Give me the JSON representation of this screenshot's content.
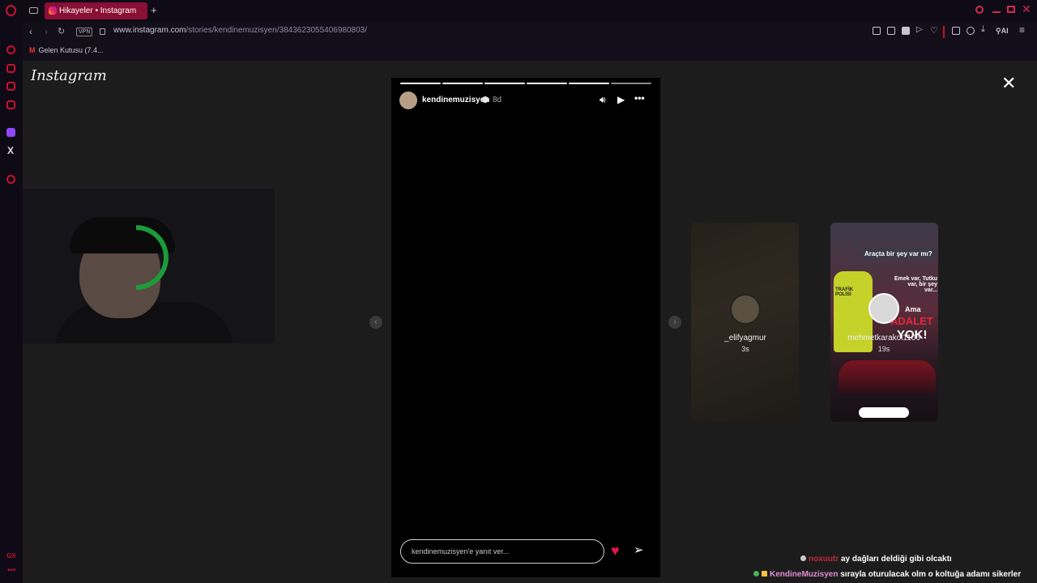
{
  "browser": {
    "tab_title": "Hikayeler • Instagram",
    "new_tab_symbol": "+",
    "vpn_label": "VPN",
    "url_domain": "www.instagram.com",
    "url_path": "/stories/kendinemuzisyen/3843623055406980803/",
    "ai_label": "AI",
    "bookmark_label": "Gelen Kutusu (7.4..."
  },
  "page": {
    "logo": "Instagram",
    "close_symbol": "✕"
  },
  "story": {
    "username": "kendinemuzisyen",
    "time_ago": "8d",
    "progress_segments": [
      1,
      1,
      1,
      1,
      1,
      0
    ],
    "reply_placeholder": "kendinemuzisyen'e yanıt ver...",
    "icons": [
      "sound-icon",
      "play-icon",
      "more-icon",
      "heart-icon",
      "send-icon"
    ]
  },
  "next_stories": [
    {
      "username": "_elifyagmur",
      "time_ago": "3s"
    },
    {
      "username": "mehmetkarakol1106",
      "time_ago": "19s",
      "card_text_top": "Araçta bir şey var mı?",
      "card_text_mid": "Emek var, Tutku var, bir şey var...",
      "card_text_big1": "Ama",
      "card_text_big2": "ADALET",
      "card_text_big3": "YOK!",
      "badge": "TRAFİK POLİSİ"
    }
  ],
  "chat": [
    {
      "user": "noxuutr",
      "message": "ay dağları deldiği gibi olcaktı"
    },
    {
      "user": "KendineMuzisyen",
      "message": "sırayla oturulacak olm o koltuğa adamı sikerler"
    }
  ],
  "colors": {
    "tab_active": "#8a0f34",
    "accent": "#e0174a",
    "page_bg": "#1c1c1c"
  }
}
